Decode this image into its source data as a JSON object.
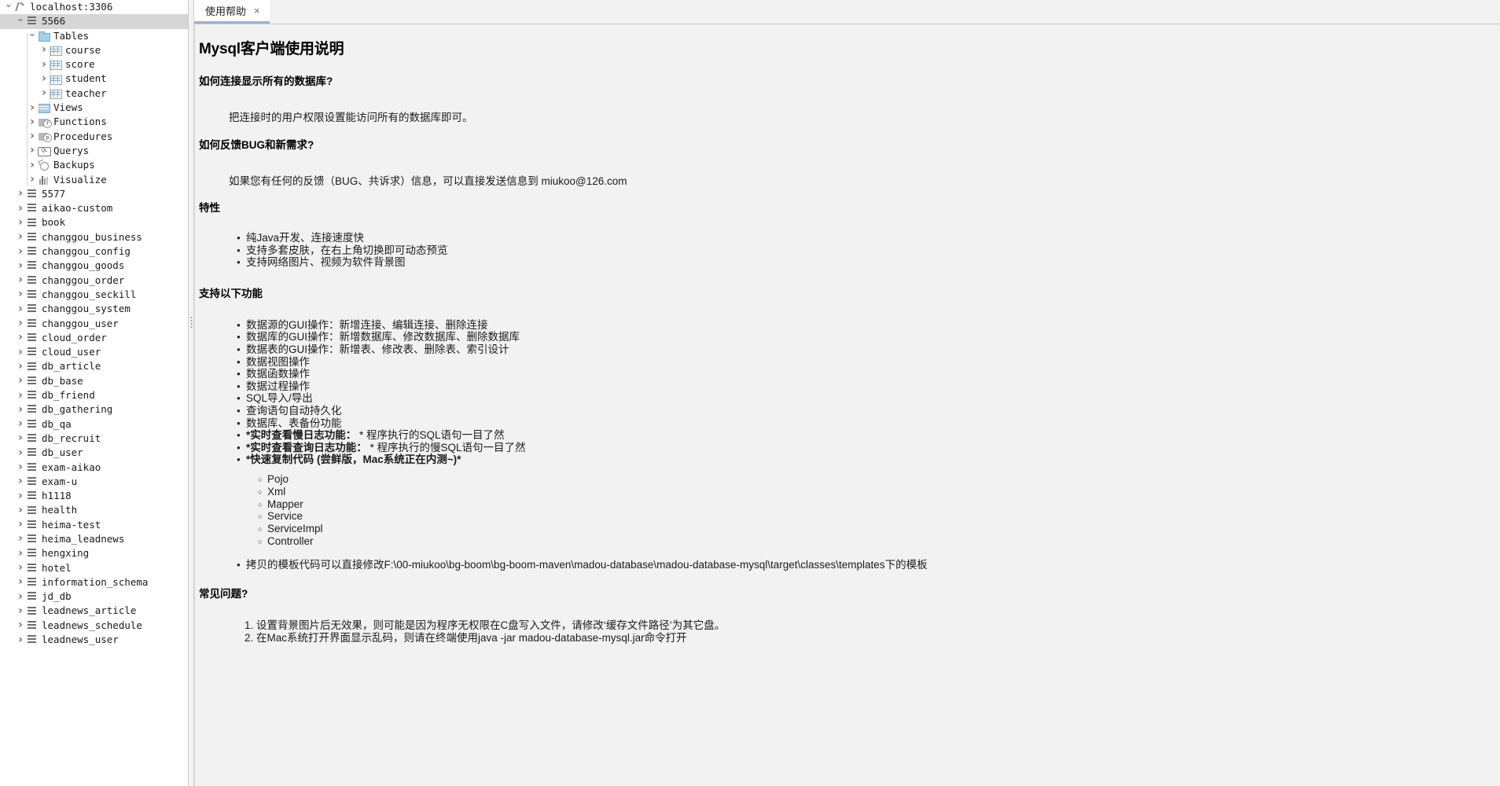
{
  "sidebar": {
    "nodes": [
      {
        "label": "localhost:3306",
        "indent": 0,
        "twisty": "open",
        "icon": "host-icon",
        "selected": false
      },
      {
        "label": "5566",
        "indent": 1,
        "twisty": "open",
        "icon": "database-icon",
        "selected": true
      },
      {
        "label": "Tables",
        "indent": 2,
        "twisty": "open",
        "icon": "folder-icon",
        "selected": false
      },
      {
        "label": "course",
        "indent": 3,
        "twisty": "closed",
        "icon": "table-icon",
        "selected": false
      },
      {
        "label": "score",
        "indent": 3,
        "twisty": "closed",
        "icon": "table-icon",
        "selected": false
      },
      {
        "label": "student",
        "indent": 3,
        "twisty": "closed",
        "icon": "table-icon",
        "selected": false
      },
      {
        "label": "teacher",
        "indent": 3,
        "twisty": "closed",
        "icon": "table-icon",
        "selected": false
      },
      {
        "label": "Views",
        "indent": 2,
        "twisty": "closed",
        "icon": "views-icon",
        "selected": false
      },
      {
        "label": "Functions",
        "indent": 2,
        "twisty": "closed",
        "icon": "function-icon",
        "selected": false
      },
      {
        "label": "Procedures",
        "indent": 2,
        "twisty": "closed",
        "icon": "procedure-icon",
        "selected": false
      },
      {
        "label": "Querys",
        "indent": 2,
        "twisty": "closed",
        "icon": "query-icon",
        "selected": false
      },
      {
        "label": "Backups",
        "indent": 2,
        "twisty": "closed",
        "icon": "backup-icon",
        "selected": false
      },
      {
        "label": "Visualize",
        "indent": 2,
        "twisty": "closed",
        "icon": "chart-icon",
        "selected": false
      },
      {
        "label": "5577",
        "indent": 1,
        "twisty": "closed",
        "icon": "database-icon",
        "selected": false
      },
      {
        "label": "aikao-custom",
        "indent": 1,
        "twisty": "closed",
        "icon": "database-icon",
        "selected": false
      },
      {
        "label": "book",
        "indent": 1,
        "twisty": "closed",
        "icon": "database-icon",
        "selected": false
      },
      {
        "label": "changgou_business",
        "indent": 1,
        "twisty": "closed",
        "icon": "database-icon",
        "selected": false
      },
      {
        "label": "changgou_config",
        "indent": 1,
        "twisty": "closed",
        "icon": "database-icon",
        "selected": false
      },
      {
        "label": "changgou_goods",
        "indent": 1,
        "twisty": "closed",
        "icon": "database-icon",
        "selected": false
      },
      {
        "label": "changgou_order",
        "indent": 1,
        "twisty": "closed",
        "icon": "database-icon",
        "selected": false
      },
      {
        "label": "changgou_seckill",
        "indent": 1,
        "twisty": "closed",
        "icon": "database-icon",
        "selected": false
      },
      {
        "label": "changgou_system",
        "indent": 1,
        "twisty": "closed",
        "icon": "database-icon",
        "selected": false
      },
      {
        "label": "changgou_user",
        "indent": 1,
        "twisty": "closed",
        "icon": "database-icon",
        "selected": false
      },
      {
        "label": "cloud_order",
        "indent": 1,
        "twisty": "closed",
        "icon": "database-icon",
        "selected": false
      },
      {
        "label": "cloud_user",
        "indent": 1,
        "twisty": "closed",
        "icon": "database-icon",
        "selected": false
      },
      {
        "label": "db_article",
        "indent": 1,
        "twisty": "closed",
        "icon": "database-icon",
        "selected": false
      },
      {
        "label": "db_base",
        "indent": 1,
        "twisty": "closed",
        "icon": "database-icon",
        "selected": false
      },
      {
        "label": "db_friend",
        "indent": 1,
        "twisty": "closed",
        "icon": "database-icon",
        "selected": false
      },
      {
        "label": "db_gathering",
        "indent": 1,
        "twisty": "closed",
        "icon": "database-icon",
        "selected": false
      },
      {
        "label": "db_qa",
        "indent": 1,
        "twisty": "closed",
        "icon": "database-icon",
        "selected": false
      },
      {
        "label": "db_recruit",
        "indent": 1,
        "twisty": "closed",
        "icon": "database-icon",
        "selected": false
      },
      {
        "label": "db_user",
        "indent": 1,
        "twisty": "closed",
        "icon": "database-icon",
        "selected": false
      },
      {
        "label": "exam-aikao",
        "indent": 1,
        "twisty": "closed",
        "icon": "database-icon",
        "selected": false
      },
      {
        "label": "exam-u",
        "indent": 1,
        "twisty": "closed",
        "icon": "database-icon",
        "selected": false
      },
      {
        "label": "h1118",
        "indent": 1,
        "twisty": "closed",
        "icon": "database-icon",
        "selected": false
      },
      {
        "label": "health",
        "indent": 1,
        "twisty": "closed",
        "icon": "database-icon",
        "selected": false
      },
      {
        "label": "heima-test",
        "indent": 1,
        "twisty": "closed",
        "icon": "database-icon",
        "selected": false
      },
      {
        "label": "heima_leadnews",
        "indent": 1,
        "twisty": "closed",
        "icon": "database-icon",
        "selected": false
      },
      {
        "label": "hengxing",
        "indent": 1,
        "twisty": "closed",
        "icon": "database-icon",
        "selected": false
      },
      {
        "label": "hotel",
        "indent": 1,
        "twisty": "closed",
        "icon": "database-icon",
        "selected": false
      },
      {
        "label": "information_schema",
        "indent": 1,
        "twisty": "closed",
        "icon": "database-icon",
        "selected": false
      },
      {
        "label": "jd_db",
        "indent": 1,
        "twisty": "closed",
        "icon": "database-icon",
        "selected": false
      },
      {
        "label": "leadnews_article",
        "indent": 1,
        "twisty": "closed",
        "icon": "database-icon",
        "selected": false
      },
      {
        "label": "leadnews_schedule",
        "indent": 1,
        "twisty": "closed",
        "icon": "database-icon",
        "selected": false
      },
      {
        "label": "leadnews_user",
        "indent": 1,
        "twisty": "closed",
        "icon": "database-icon",
        "selected": false
      }
    ]
  },
  "tabs": [
    {
      "label": "使用帮助",
      "close": "×",
      "active": true
    }
  ],
  "doc": {
    "title": "Mysql客户端使用说明",
    "section1_heading": "如何连接显示所有的数据库?",
    "section1_text": "把连接时的用户权限设置能访问所有的数据库即可。",
    "section2_heading": "如何反馈BUG和新需求?",
    "section2_text": "如果您有任何的反馈（BUG、共诉求）信息，可以直接发送信息到 miukoo@126.com",
    "features_heading": "特性",
    "features": [
      "纯Java开发、连接速度快",
      "支持多套皮肤，在右上角切换即可动态预览",
      "支持网络图片、视频为软件背景图"
    ],
    "functions_heading": "支持以下功能",
    "functions": [
      {
        "text": "数据源的GUI操作：新增连接、编辑连接、删除连接",
        "bold_prefix": "",
        "rest": ""
      },
      {
        "text": "数据库的GUI操作：新增数据库、修改数据库、删除数据库",
        "bold_prefix": "",
        "rest": ""
      },
      {
        "text": "数据表的GUI操作：新增表、修改表、删除表、索引设计",
        "bold_prefix": "",
        "rest": ""
      },
      {
        "text": "数据视图操作",
        "bold_prefix": "",
        "rest": ""
      },
      {
        "text": "数据函数操作",
        "bold_prefix": "",
        "rest": ""
      },
      {
        "text": "数据过程操作",
        "bold_prefix": "",
        "rest": ""
      },
      {
        "text": "SQL导入/导出",
        "bold_prefix": "",
        "rest": ""
      },
      {
        "text": "查询语句自动持久化",
        "bold_prefix": "",
        "rest": ""
      },
      {
        "text": "数据库、表备份功能",
        "bold_prefix": "",
        "rest": ""
      },
      {
        "text": "",
        "bold_prefix": "*实时查看慢日志功能：",
        "rest": " * 程序执行的SQL语句一目了然"
      },
      {
        "text": "",
        "bold_prefix": "*实时查看查询日志功能：",
        "rest": " * 程序执行的慢SQL语句一目了然"
      },
      {
        "text": "",
        "bold_prefix": "*快速复制代码 (尝鲜版，Mac系统正在内测~)*",
        "rest": ""
      }
    ],
    "codegen_items": [
      "Pojo",
      "Xml",
      "Mapper",
      "Service",
      "ServiceImpl",
      "Controller"
    ],
    "template_note": "拷贝的模板代码可以直接修改F:\\00-miukoo\\bg-boom\\bg-boom-maven\\madou-database\\madou-database-mysql\\target\\classes\\templates下的模板",
    "faq_heading": "常见问题?",
    "faq": [
      "1. 设置背景图片后无效果，则可能是因为程序无权限在C盘写入文件，请修改‘缓存文件路径’为其它盘。",
      "2. 在Mac系统打开界面显示乱码，则请在终端使用java -jar madou-database-mysql.jar命令打开"
    ]
  },
  "colors": {
    "selection": "#d6d6d6",
    "tab_underline": "#9fb0cc",
    "panel_bg": "#f2f2f2",
    "sidebar_bg": "#ffffff"
  }
}
